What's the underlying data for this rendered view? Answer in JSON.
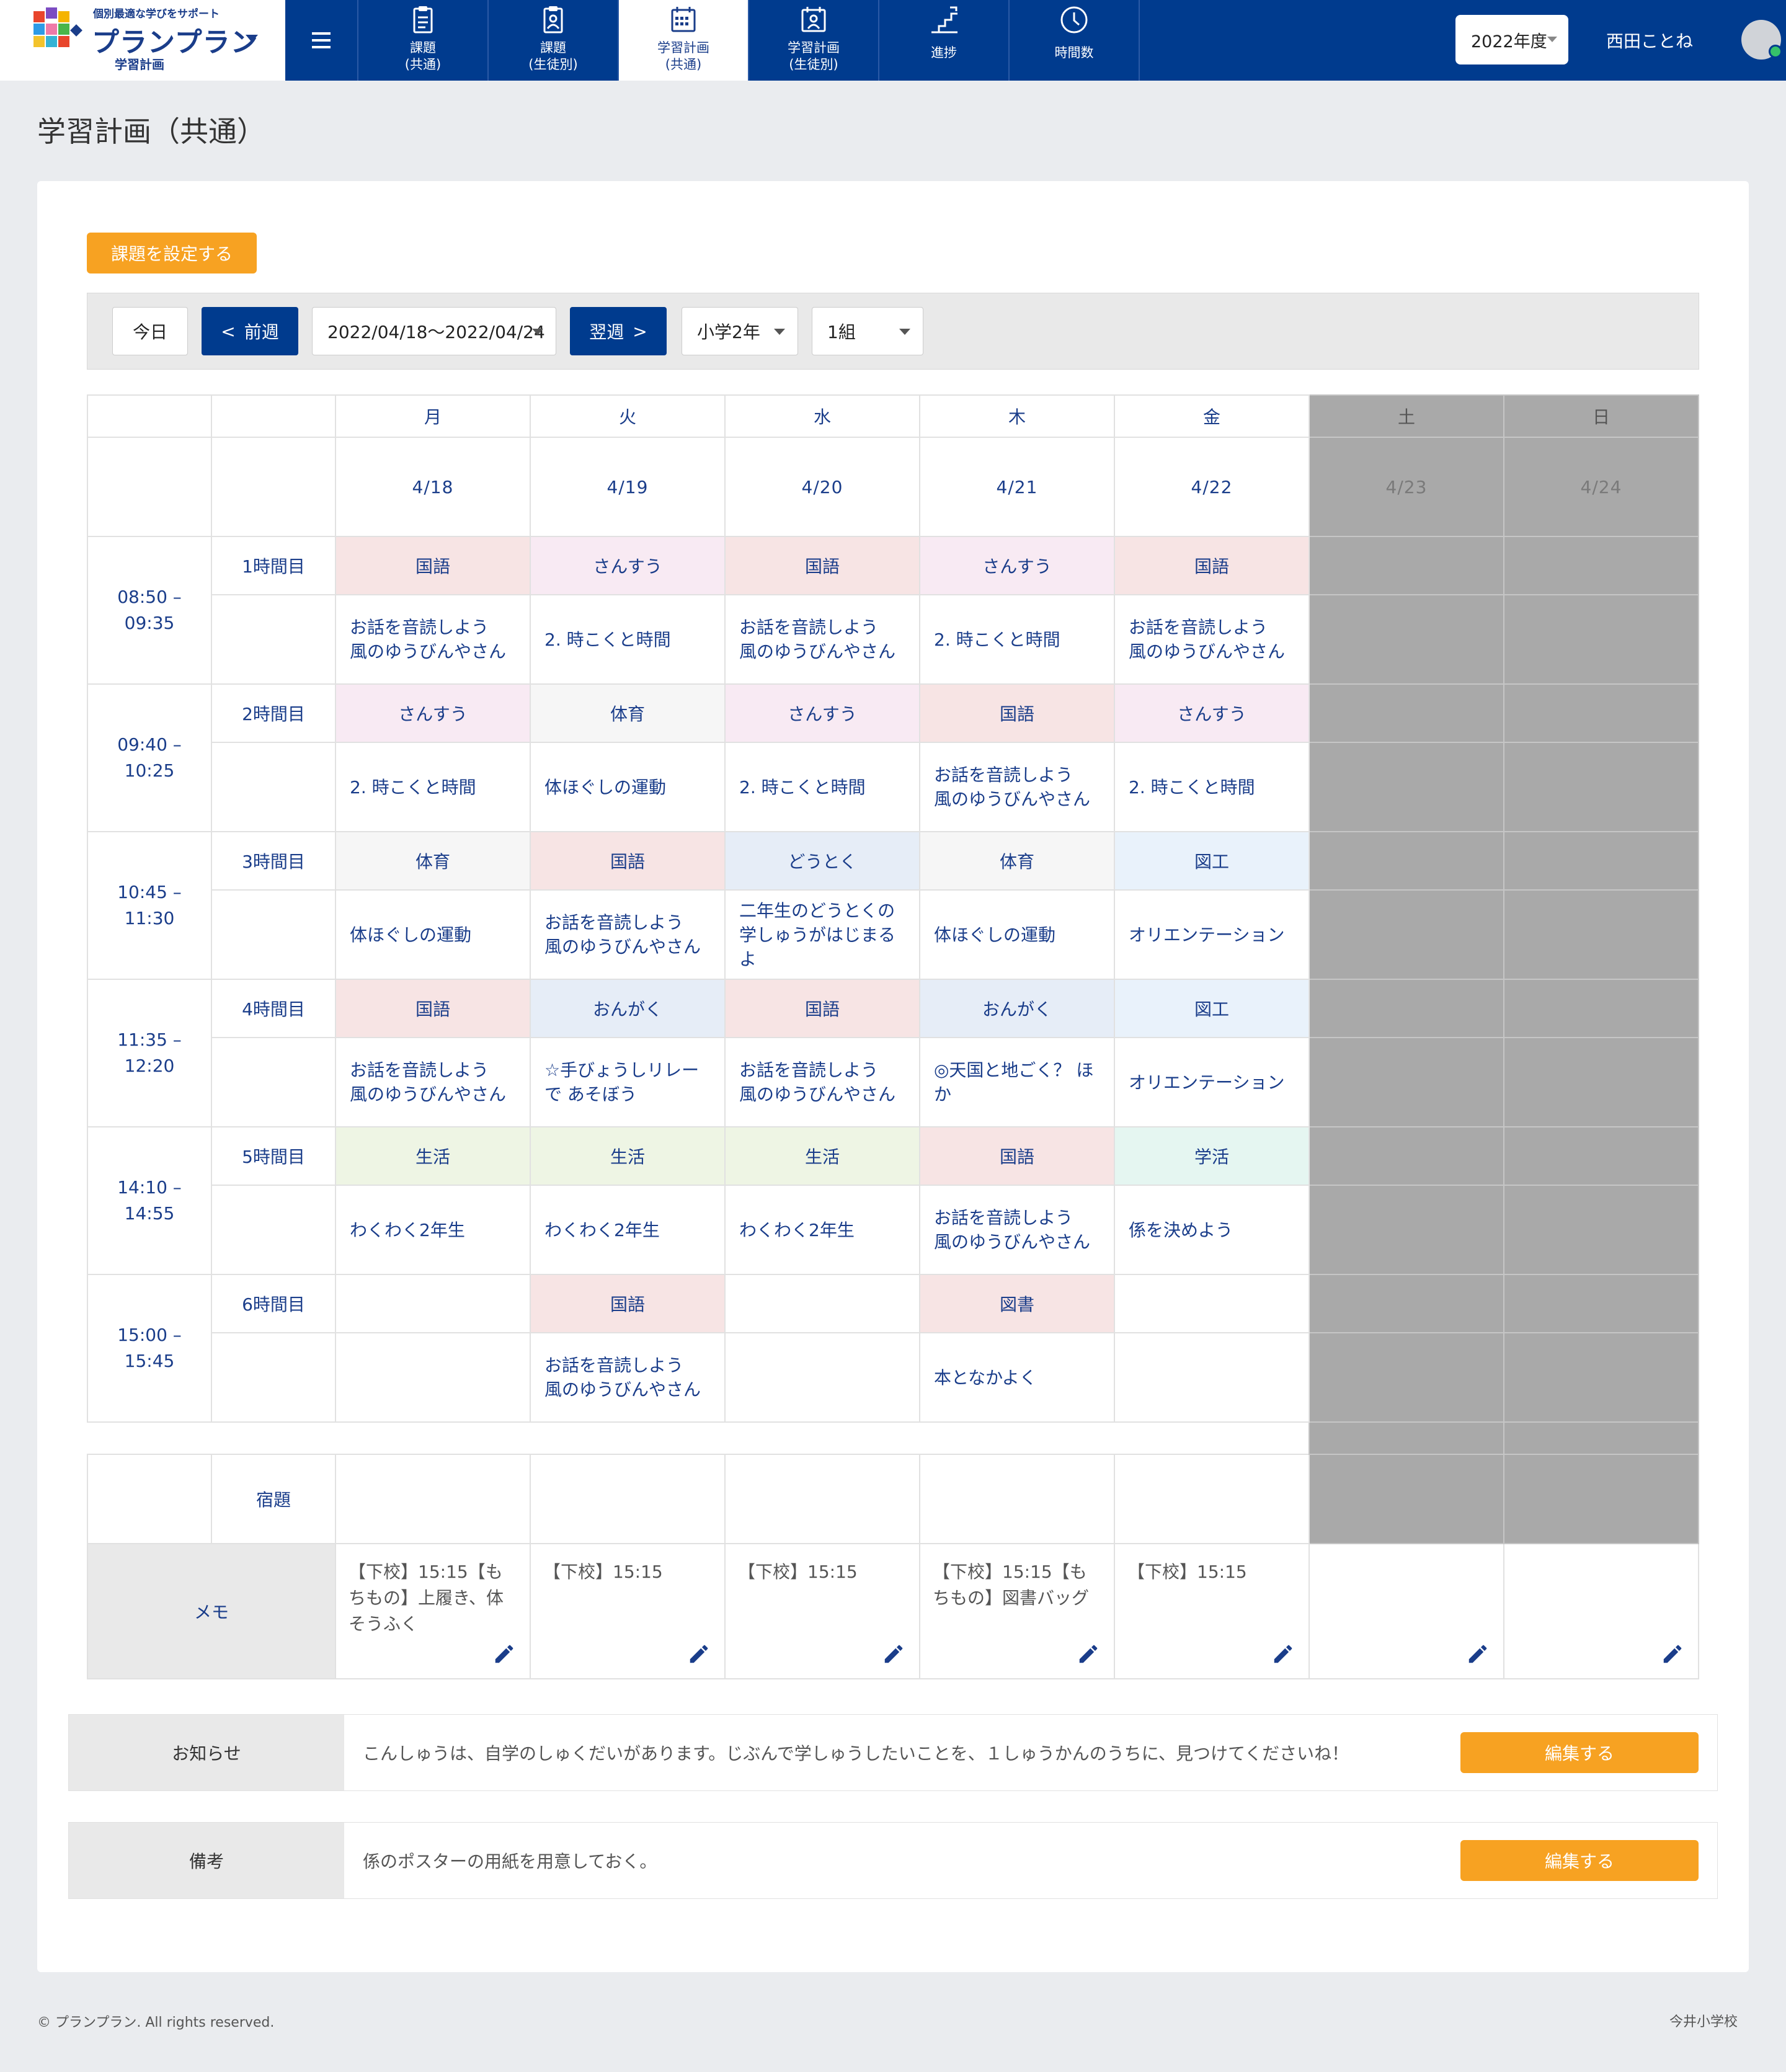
{
  "header": {
    "logo_tagline": "個別最適な学びをサポート",
    "logo_name": "プランプラン",
    "logo_sub": "学習計画",
    "tabs": [
      {
        "line1": "課題",
        "line2": "(共通)",
        "icon": "clipboard-icon",
        "active": false
      },
      {
        "line1": "課題",
        "line2": "(生徒別)",
        "icon": "id-badge-icon",
        "active": false
      },
      {
        "line1": "学習計画",
        "line2": "(共通)",
        "icon": "calendar-icon",
        "active": true
      },
      {
        "line1": "学習計画",
        "line2": "(生徒別)",
        "icon": "calendar-person-icon",
        "active": false
      },
      {
        "line1": "進捗",
        "line2": "",
        "icon": "stairs-icon",
        "active": false
      },
      {
        "line1": "時間数",
        "line2": "",
        "icon": "clock-icon",
        "active": false
      }
    ],
    "year_select": "2022年度",
    "user_name": "西田ことね"
  },
  "page_title": "学習計画（共通）",
  "set_task_button": "課題を設定する",
  "toolbar": {
    "today": "今日",
    "prev": "前週",
    "range": "2022/04/18〜2022/04/24",
    "next": "翌週",
    "grade": "小学2年",
    "class": "1組"
  },
  "days": [
    {
      "dow": "月",
      "date": "4/18",
      "weekend": false
    },
    {
      "dow": "火",
      "date": "4/19",
      "weekend": false
    },
    {
      "dow": "水",
      "date": "4/20",
      "weekend": false
    },
    {
      "dow": "木",
      "date": "4/21",
      "weekend": false
    },
    {
      "dow": "金",
      "date": "4/22",
      "weekend": false
    },
    {
      "dow": "土",
      "date": "4/23",
      "weekend": true
    },
    {
      "dow": "日",
      "date": "4/24",
      "weekend": true
    }
  ],
  "periods": [
    {
      "label": "1時間目",
      "start": "08:50 –",
      "end": "09:35",
      "cells": [
        {
          "subject": "国語",
          "topic": "お話を音読しよう\n風のゆうびんやさん",
          "cls": "s-kokugo"
        },
        {
          "subject": "さんすう",
          "topic": "2. 時こくと時間",
          "cls": "s-sansu"
        },
        {
          "subject": "国語",
          "topic": "お話を音読しよう\n風のゆうびんやさん",
          "cls": "s-kokugo"
        },
        {
          "subject": "さんすう",
          "topic": "2. 時こくと時間",
          "cls": "s-sansu"
        },
        {
          "subject": "国語",
          "topic": "お話を音読しよう\n風のゆうびんやさん",
          "cls": "s-kokugo"
        }
      ]
    },
    {
      "label": "2時間目",
      "start": "09:40 –",
      "end": "10:25",
      "cells": [
        {
          "subject": "さんすう",
          "topic": "2. 時こくと時間",
          "cls": "s-sansu"
        },
        {
          "subject": "体育",
          "topic": "体ほぐしの運動",
          "cls": "s-taiiku"
        },
        {
          "subject": "さんすう",
          "topic": "2. 時こくと時間",
          "cls": "s-sansu"
        },
        {
          "subject": "国語",
          "topic": "お話を音読しよう\n風のゆうびんやさん",
          "cls": "s-kokugo"
        },
        {
          "subject": "さんすう",
          "topic": "2. 時こくと時間",
          "cls": "s-sansu"
        }
      ]
    },
    {
      "label": "3時間目",
      "start": "10:45 –",
      "end": "11:30",
      "cells": [
        {
          "subject": "体育",
          "topic": "体ほぐしの運動",
          "cls": "s-taiiku"
        },
        {
          "subject": "国語",
          "topic": "お話を音読しよう\n風のゆうびんやさん",
          "cls": "s-kokugo"
        },
        {
          "subject": "どうとく",
          "topic": "二年生のどうとくの\n学しゅうがはじまる\nよ",
          "cls": "s-doutoku"
        },
        {
          "subject": "体育",
          "topic": "体ほぐしの運動",
          "cls": "s-taiiku"
        },
        {
          "subject": "図工",
          "topic": "オリエンテーション",
          "cls": "s-zukou"
        }
      ]
    },
    {
      "label": "4時間目",
      "start": "11:35 –",
      "end": "12:20",
      "cells": [
        {
          "subject": "国語",
          "topic": "お話を音読しよう\n風のゆうびんやさん",
          "cls": "s-kokugo"
        },
        {
          "subject": "おんがく",
          "topic": "☆手びょうしリレー\nで あそぼう",
          "cls": "s-ongaku"
        },
        {
          "subject": "国語",
          "topic": "お話を音読しよう\n風のゆうびんやさん",
          "cls": "s-kokugo"
        },
        {
          "subject": "おんがく",
          "topic": "◎天国と地ごく？ ほ\nか",
          "cls": "s-ongaku"
        },
        {
          "subject": "図工",
          "topic": "オリエンテーション",
          "cls": "s-zukou"
        }
      ]
    },
    {
      "label": "5時間目",
      "start": "14:10 –",
      "end": "14:55",
      "cells": [
        {
          "subject": "生活",
          "topic": "わくわく2年生",
          "cls": "s-seikatsu"
        },
        {
          "subject": "生活",
          "topic": "わくわく2年生",
          "cls": "s-seikatsu"
        },
        {
          "subject": "生活",
          "topic": "わくわく2年生",
          "cls": "s-seikatsu"
        },
        {
          "subject": "国語",
          "topic": "お話を音読しよう\n風のゆうびんやさん",
          "cls": "s-kokugo"
        },
        {
          "subject": "学活",
          "topic": "係を決めよう",
          "cls": "s-gakkatsu"
        }
      ]
    },
    {
      "label": "6時間目",
      "start": "15:00 –",
      "end": "15:45",
      "cells": [
        {
          "subject": "",
          "topic": "",
          "cls": ""
        },
        {
          "subject": "国語",
          "topic": "お話を音読しよう\n風のゆうびんやさん",
          "cls": "s-kokugo"
        },
        {
          "subject": "",
          "topic": "",
          "cls": ""
        },
        {
          "subject": "図書",
          "topic": "本となかよく",
          "cls": "s-tosho"
        },
        {
          "subject": "",
          "topic": "",
          "cls": ""
        }
      ]
    }
  ],
  "homework_label": "宿題",
  "memo_label": "メモ",
  "memos": [
    "【下校】15:15【もちもの】上履き、体そうふく",
    "【下校】15:15",
    "【下校】15:15",
    "【下校】15:15【もちもの】図書バッグ",
    "【下校】15:15",
    "",
    ""
  ],
  "notice": {
    "label": "お知らせ",
    "text": "こんしゅうは、自学のしゅくだいがあります。じぶんで学しゅうしたいことを、１しゅうかんのうちに、見つけてくださいね！",
    "button": "編集する"
  },
  "remarks": {
    "label": "備考",
    "text": "係のポスターの用紙を用意しておく。",
    "button": "編集する"
  },
  "footer": {
    "copyright": "©  プランプラン. All rights reserved.",
    "school": "今井小学校"
  },
  "colors": {
    "nav": "#003b8e",
    "accent_orange": "#f7a222",
    "weekend_gray": "#a9a9a9"
  }
}
